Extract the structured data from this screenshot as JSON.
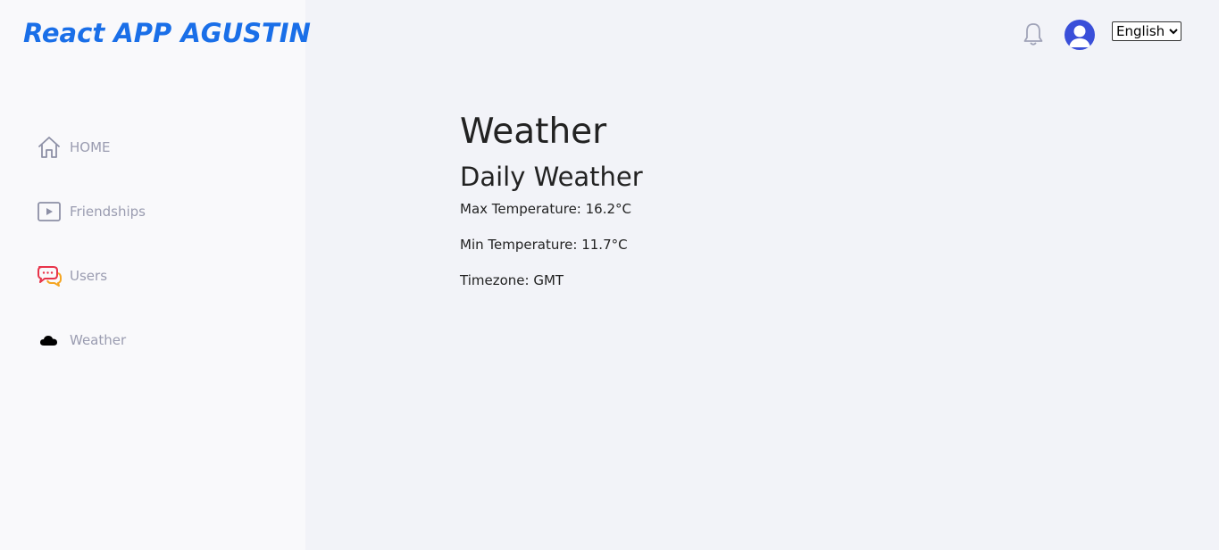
{
  "brand": {
    "title": "React APP AGUSTIN",
    "color": "#1a6fe8"
  },
  "sidebar": {
    "items": [
      {
        "label": "HOME",
        "icon": "home-icon"
      },
      {
        "label": "Friendships",
        "icon": "play-icon"
      },
      {
        "label": "Users",
        "icon": "chat-bubbles-icon"
      },
      {
        "label": "Weather",
        "icon": "cloud-icon"
      }
    ]
  },
  "header": {
    "notification_icon": "bell-icon",
    "avatar_icon": "user-avatar-icon",
    "language": {
      "selected": "English",
      "options": [
        "English"
      ]
    }
  },
  "main": {
    "title": "Weather",
    "subtitle": "Daily Weather",
    "max_temperature": "Max Temperature: 16.2°C",
    "min_temperature": "Min Temperature: 11.7°C",
    "timezone": "Timezone: GMT"
  }
}
